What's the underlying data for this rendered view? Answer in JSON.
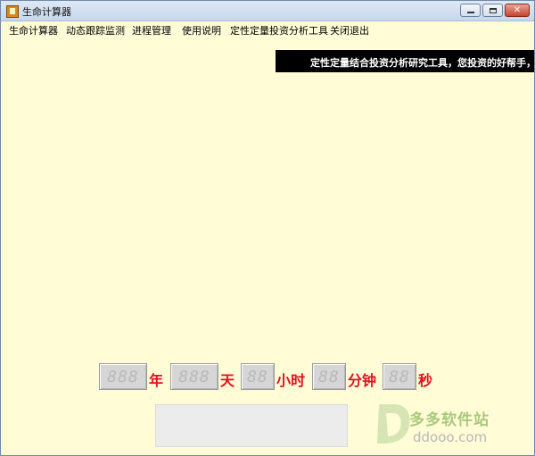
{
  "window": {
    "title": "生命计算器",
    "controls": {
      "minimize": "minimize",
      "maximize": "maximize",
      "close": "✕"
    }
  },
  "menu": {
    "items": [
      {
        "label": "生命计算器"
      },
      {
        "label": "动态跟踪监测"
      },
      {
        "label": "进程管理"
      },
      {
        "label": "使用说明"
      },
      {
        "label": "定性定量投资分析工具"
      },
      {
        "label": "关闭退出"
      }
    ]
  },
  "banner": {
    "text": "定性定量结合投资分析研究工具，您投资的好帮手，将"
  },
  "countdown": {
    "years": {
      "display": "888",
      "unit": "年"
    },
    "days": {
      "display": "888",
      "unit": "天"
    },
    "hours": {
      "display": "88",
      "unit": "小时"
    },
    "minutes": {
      "display": "88",
      "unit": "分钟"
    },
    "seconds": {
      "display": "88",
      "unit": "秒"
    }
  },
  "watermark": {
    "cn": "多多软件站",
    "en": "ddooo.com"
  },
  "colors": {
    "background": "#fffcd6",
    "banner_bg": "#000000",
    "unit_text": "#e0101f",
    "segment_bg": "#d6d6d6"
  },
  "icons": {
    "app": "app-icon",
    "watermark_logo": "ddooo-logo-icon"
  }
}
